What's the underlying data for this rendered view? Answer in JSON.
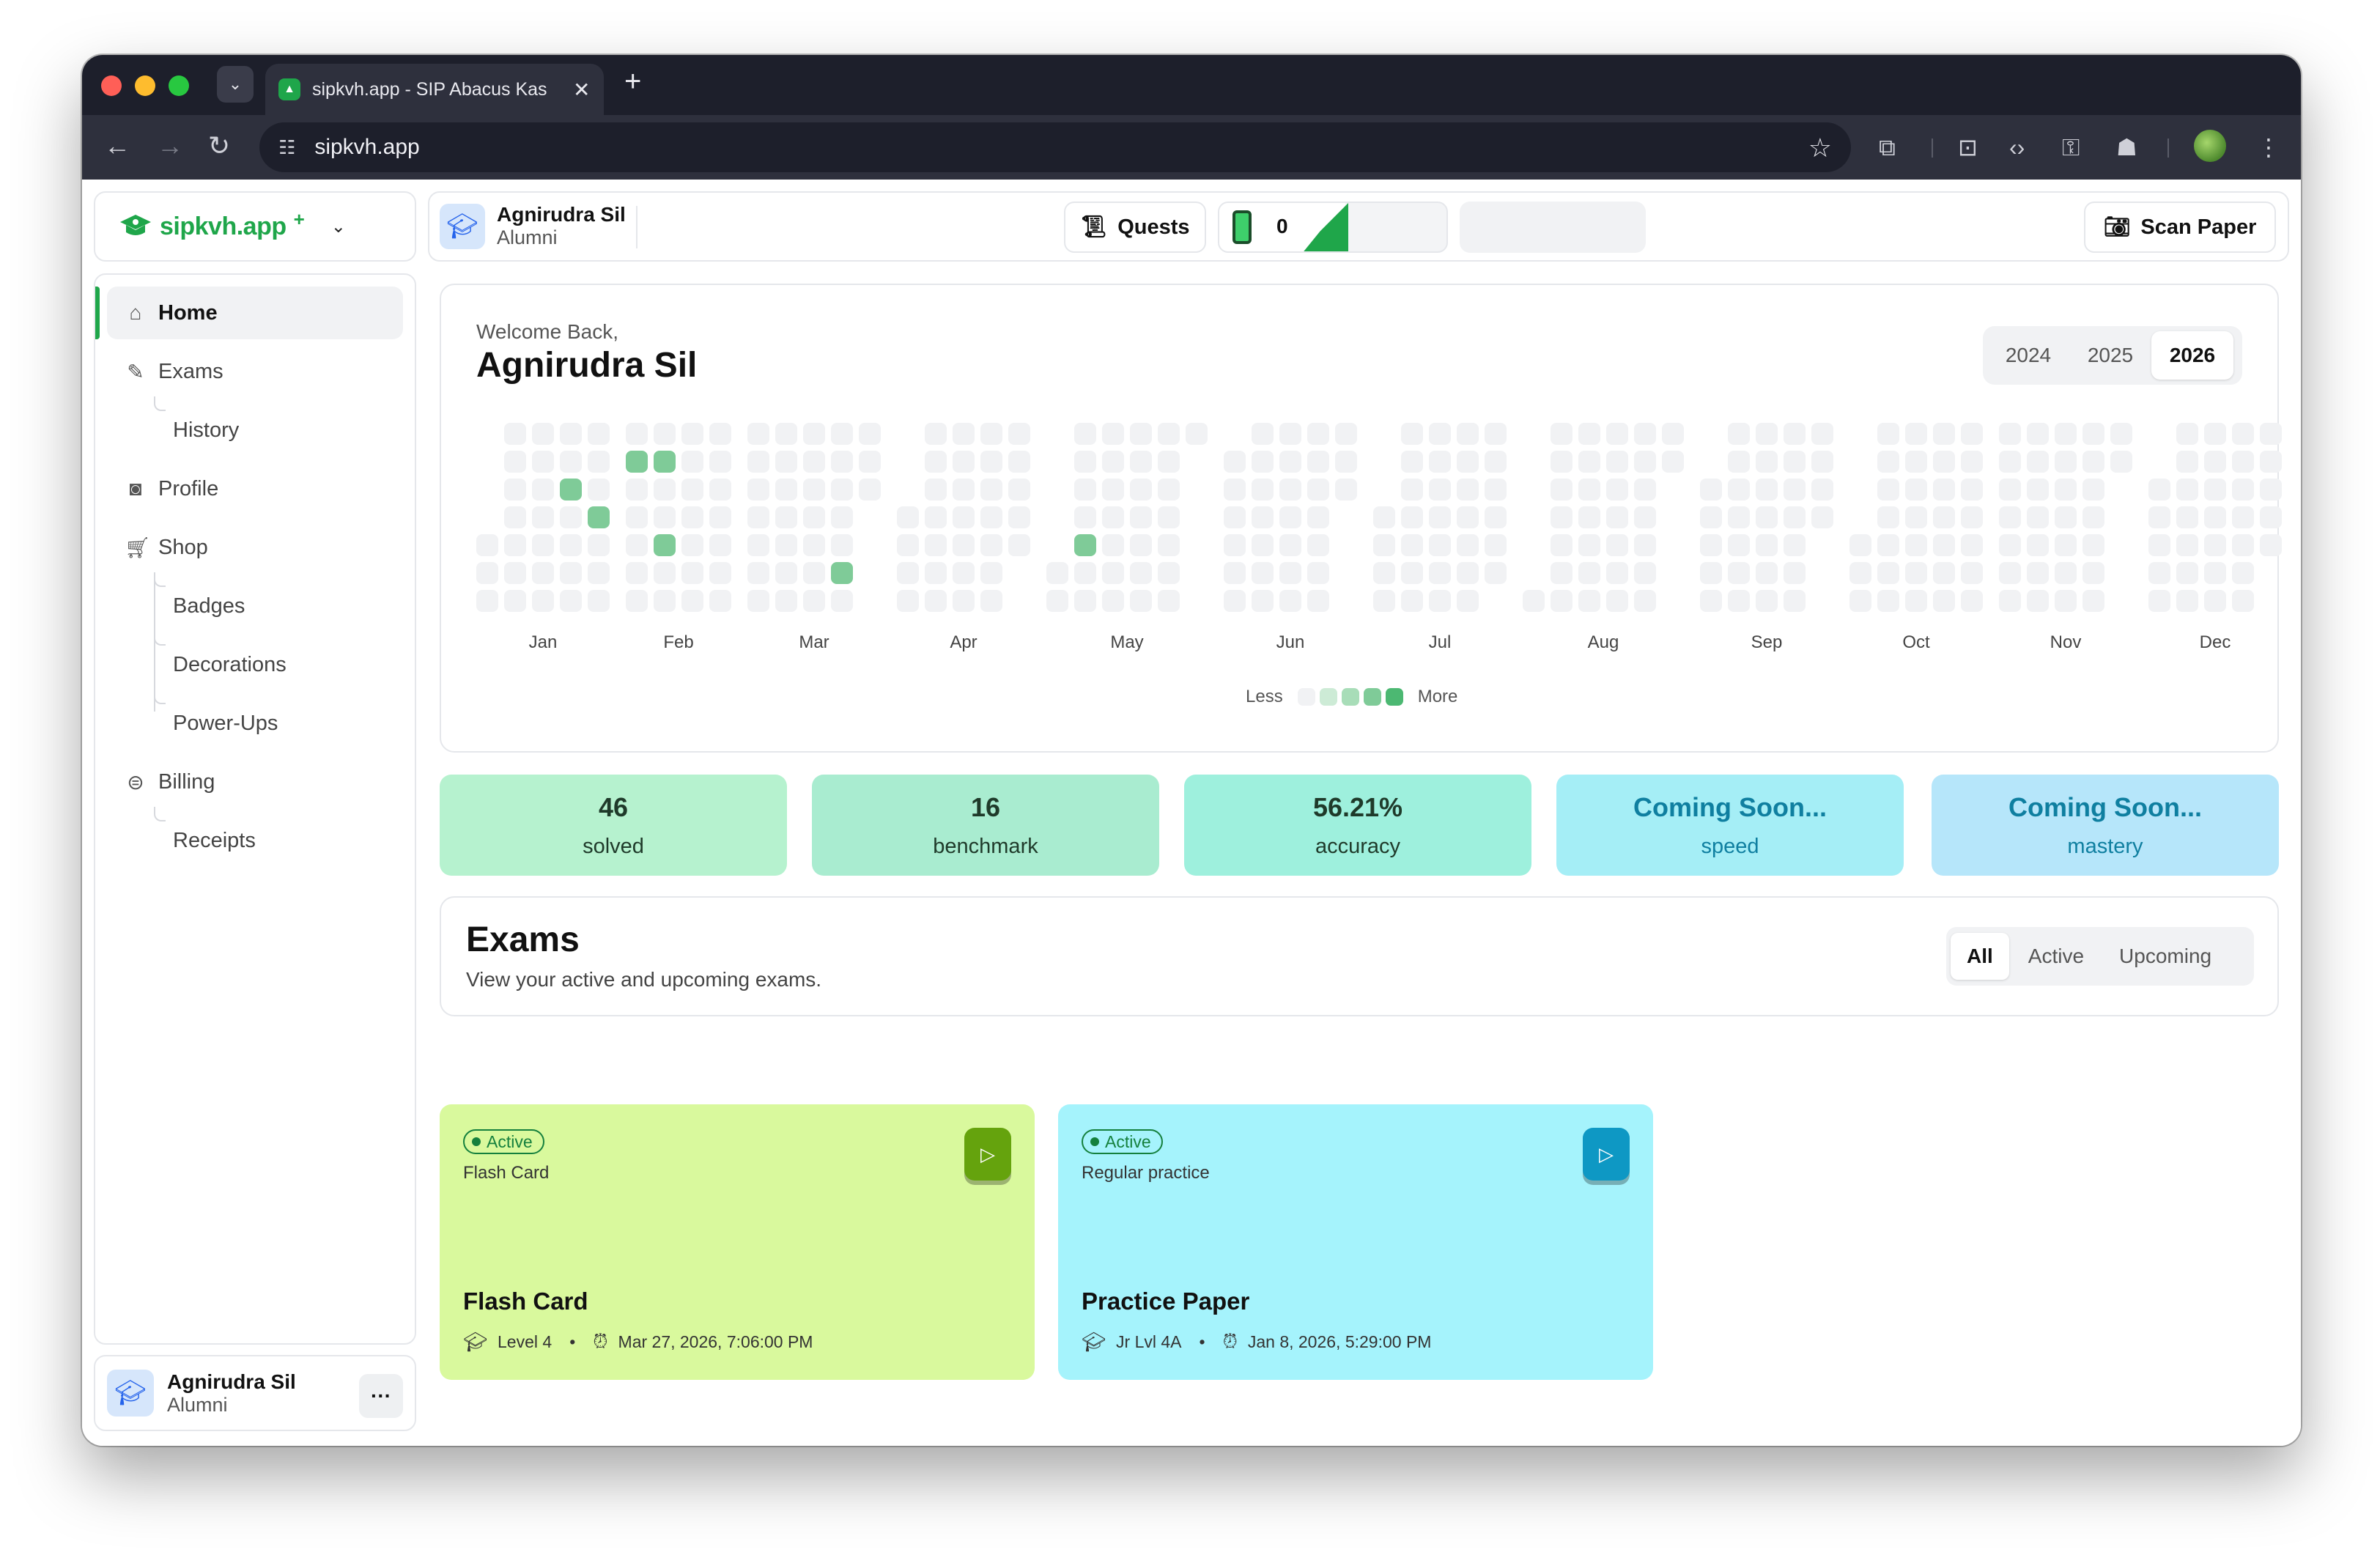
{
  "browser": {
    "tab_title": "sipkvh.app - SIP Abacus Kas",
    "url": "sipkvh.app"
  },
  "brand": {
    "name": "sipkvh.app",
    "plus": "+"
  },
  "sidebar": {
    "items": [
      {
        "label": "Home",
        "icon": "home-icon"
      },
      {
        "label": "Exams",
        "icon": "exams-icon"
      },
      {
        "label": "History"
      },
      {
        "label": "Profile",
        "icon": "profile-icon"
      },
      {
        "label": "Shop",
        "icon": "cart-icon"
      },
      {
        "label": "Badges"
      },
      {
        "label": "Decorations"
      },
      {
        "label": "Power-Ups"
      },
      {
        "label": "Billing",
        "icon": "billing-icon"
      },
      {
        "label": "Receipts"
      }
    ]
  },
  "user": {
    "name": "Agnirudra Sil",
    "role": "Alumni"
  },
  "topbar": {
    "quests_label": "Quests",
    "streak_count": "0",
    "scan_label": "Scan Paper"
  },
  "welcome": {
    "label": "Welcome Back,",
    "name": "Agnirudra Sil",
    "years": [
      "2024",
      "2025",
      "2026"
    ],
    "selected_year": "2026"
  },
  "heatmap": {
    "months": [
      "Jan",
      "Feb",
      "Mar",
      "Apr",
      "May",
      "Jun",
      "Jul",
      "Aug",
      "Sep",
      "Oct",
      "Nov",
      "Dec"
    ],
    "legend_less": "Less",
    "legend_more": "More",
    "colors": [
      "#f1f2f4",
      "#cdebd6",
      "#a8ddb8",
      "#7fcb98",
      "#4cb872"
    ],
    "active_days": [
      "2026-01-20",
      "2026-01-28",
      "2026-02-02",
      "2026-02-09",
      "2026-02-12",
      "2026-03-27",
      "2026-05-07"
    ]
  },
  "stats": [
    {
      "value": "46",
      "label": "solved",
      "bg": "#b6f2cf",
      "fg": "#1f3a2a"
    },
    {
      "value": "16",
      "label": "benchmark",
      "bg": "#a9ecd0",
      "fg": "#1f3a2a"
    },
    {
      "value": "56.21%",
      "label": "accuracy",
      "bg": "#9ef0dd",
      "fg": "#1f3a2a"
    },
    {
      "value": "Coming Soon...",
      "label": "speed",
      "bg": "#a5eef6",
      "fg": "#0f7fa0"
    },
    {
      "value": "Coming Soon...",
      "label": "mastery",
      "bg": "#b6e6fa",
      "fg": "#0f7fa0"
    }
  ],
  "exams": {
    "title": "Exams",
    "subtitle": "View your active and upcoming exams.",
    "filters": [
      "All",
      "Active",
      "Upcoming"
    ],
    "selected_filter": "All",
    "cards": [
      {
        "status": "Active",
        "kind": "Flash Card",
        "name": "Flash Card",
        "level": "Level 4",
        "datetime": "Mar 27, 2026, 7:06:00 PM",
        "bg": "#d9f99d",
        "accent": "#15803d",
        "play_bg": "#65a30d"
      },
      {
        "status": "Active",
        "kind": "Regular practice",
        "name": "Practice Paper",
        "level": "Jr Lvl 4A",
        "datetime": "Jan 8, 2026, 5:29:00 PM",
        "bg": "#a5f3fc",
        "accent": "#15803d",
        "play_bg": "#0e98c4"
      }
    ]
  }
}
